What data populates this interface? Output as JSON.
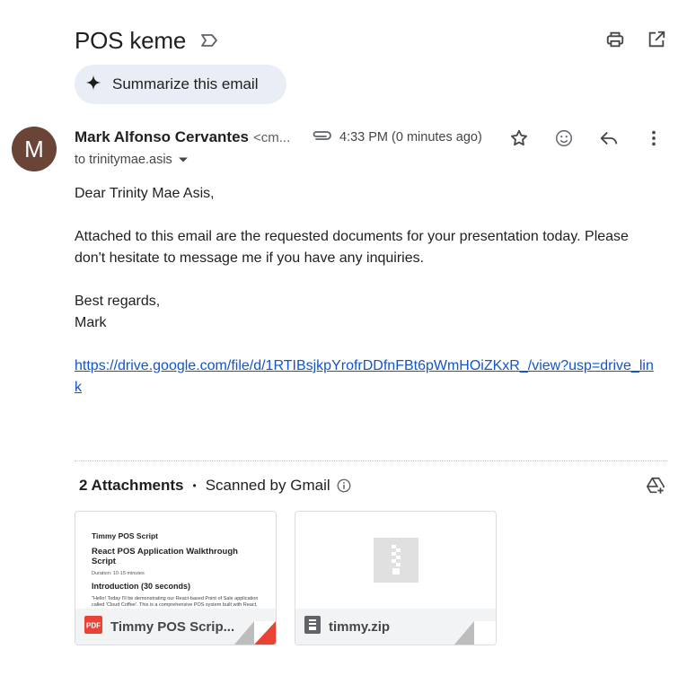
{
  "email": {
    "subject": "POS keme",
    "summarize_label": "Summarize this email",
    "sender": {
      "initial": "M",
      "name": "Mark Alfonso Cervantes",
      "email_truncated": "<cm..."
    },
    "time": "4:33 PM (0 minutes ago)",
    "to": "to trinitymae.asis",
    "body": {
      "greeting": "Dear Trinity Mae Asis,",
      "paragraph": "Attached to this email are the requested documents for your presentation today. Please don't hesitate to message me if you have any inquiries.",
      "signoff": "Best regards,",
      "signature": "Mark",
      "link": "https://drive.google.com/file/d/1RTIBsjkpYrofrDDfnFBt6pWmHOiZKxR_/view?usp=drive_link"
    }
  },
  "attachments": {
    "count_label": "2 Attachments",
    "separator": "•",
    "scanned_label": "Scanned by Gmail",
    "items": [
      {
        "name": "Timmy POS Scrip...",
        "type_icon": "pdf-icon",
        "type_label": "PDF",
        "preview": {
          "title": "Timmy POS Script",
          "heading": "React POS Application Walkthrough Script",
          "duration": "Duration: 10-15 minutes",
          "section": "Introduction (30 seconds)",
          "body": "\"Hello! Today I'll be demonstrating our React-based Point of Sale application called 'Cloud Coffee'. This is a comprehensive POS system built with React, TypeScript, and modern web technologies. Let me walk you through all the features and functionality.\""
        }
      },
      {
        "name": "timmy.zip",
        "type_icon": "zip-icon"
      }
    ]
  },
  "colors": {
    "avatar_bg": "#6b4438",
    "summarize_bg": "#e9eef6",
    "link": "#1155cc",
    "pdf_red": "#ea4335",
    "zip_gray": "#5f6368"
  }
}
